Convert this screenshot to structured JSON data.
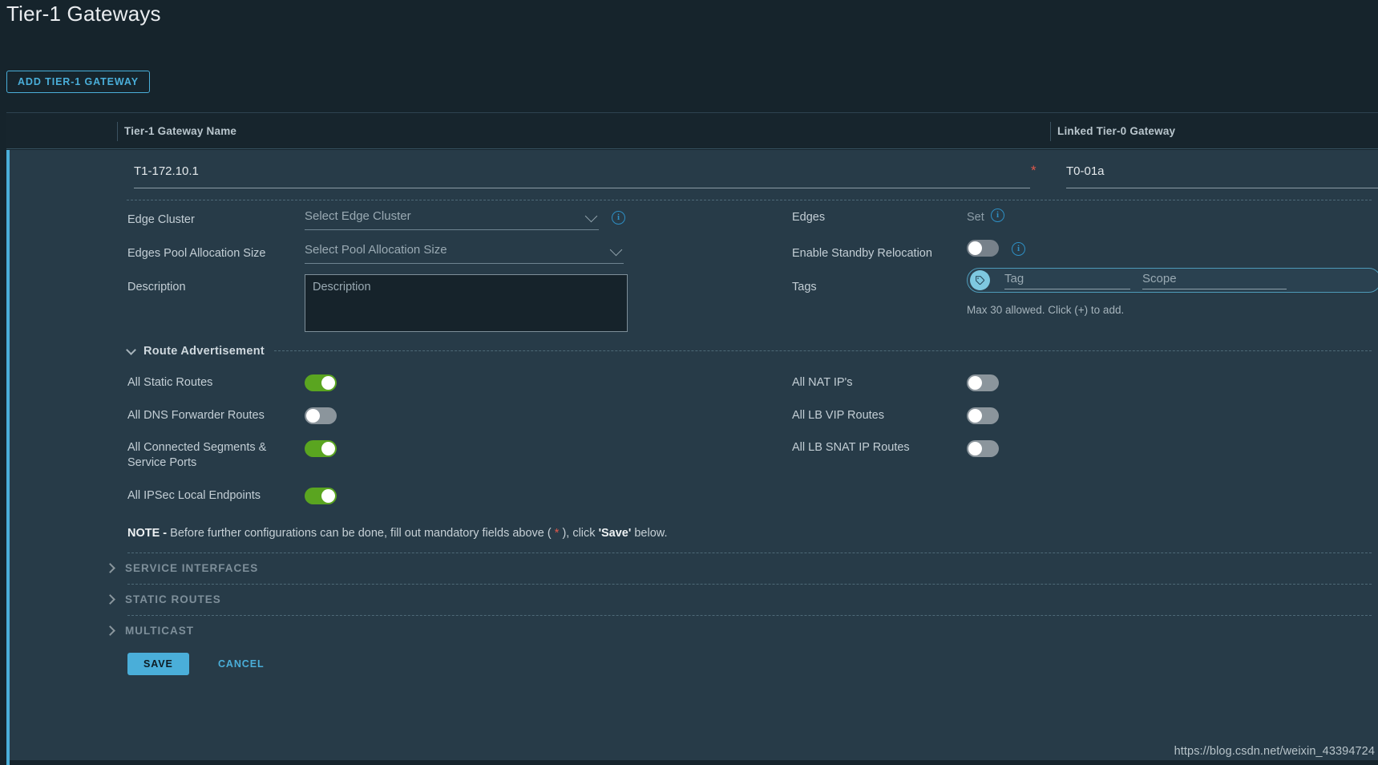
{
  "page": {
    "title": "Tier-1 Gateways",
    "add_button": "ADD TIER-1 GATEWAY"
  },
  "table": {
    "columns": [
      {
        "label": "Tier-1 Gateway Name"
      },
      {
        "label": "Linked Tier-0 Gateway"
      }
    ]
  },
  "row": {
    "gateway_name": "T1-172.10.1",
    "gateway_name_placeholder": "Tier-1 Gateway Name",
    "required_marker": "*",
    "linked_t0_gateway": "T0-01a",
    "linked_t0_placeholder": "Linked Tier-0 Gateway"
  },
  "form_left": {
    "edge_cluster_label": "Edge Cluster",
    "edge_cluster_value": "Select Edge Cluster",
    "pool_alloc_label": "Edges Pool Allocation Size",
    "pool_alloc_value": "Select Pool Allocation Size",
    "description_label": "Description",
    "description_placeholder": "Description"
  },
  "form_right": {
    "edges_label": "Edges",
    "edges_value": "Set",
    "standby_label": "Enable Standby Relocation",
    "standby_state": "off",
    "tags_label": "Tags",
    "tag_placeholder": "Tag",
    "scope_placeholder": "Scope",
    "tags_helper": "Max 30 allowed. Click (+) to add."
  },
  "route_advertisement": {
    "title": "Route Advertisement",
    "expanded": true,
    "left_toggles": [
      {
        "label": "All Static Routes",
        "state": "on"
      },
      {
        "label": "All DNS Forwarder Routes",
        "state": "off"
      },
      {
        "label": "All Connected Segments & Service Ports",
        "state": "on"
      },
      {
        "label": "All IPSec Local Endpoints",
        "state": "on"
      }
    ],
    "right_toggles": [
      {
        "label": "All NAT IP's",
        "state": "off"
      },
      {
        "label": "All LB VIP Routes",
        "state": "off"
      },
      {
        "label": "All LB SNAT IP Routes",
        "state": "off"
      }
    ]
  },
  "note": {
    "prefix": "NOTE -",
    "body_1": " Before further configurations can be done, fill out mandatory fields above ( ",
    "star": "*",
    "body_2": " ), click ",
    "save_word": "'Save'",
    "body_3": " below."
  },
  "collapsed_sections": [
    {
      "label": "SERVICE INTERFACES"
    },
    {
      "label": "STATIC ROUTES"
    },
    {
      "label": "MULTICAST"
    }
  ],
  "footer": {
    "save": "SAVE",
    "cancel": "CANCEL"
  },
  "watermark": "https://blog.csdn.net/weixin_43394724",
  "colors": {
    "accent": "#4aaed9",
    "toggle_on": "#5aa520",
    "toggle_off": "#77818a",
    "required": "#e0584b",
    "row_bg": "#273b48",
    "page_bg": "#16242c"
  }
}
